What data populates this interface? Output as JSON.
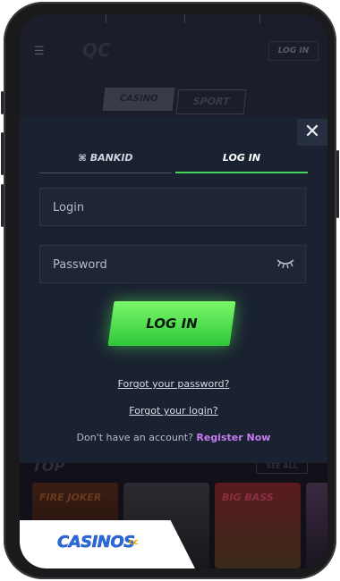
{
  "background_site": {
    "logo": "QC",
    "header_login": "LOG IN",
    "categories": [
      "CASINO",
      "SPORT"
    ],
    "section_title": "TOP",
    "see_all": "SEE ALL",
    "tiles": [
      {
        "title": "FIRE JOKER"
      },
      {
        "title": ""
      },
      {
        "title": "BIG BASS"
      },
      {
        "title": ""
      }
    ]
  },
  "modal": {
    "close_symbol": "✕",
    "tabs": [
      {
        "label": "BANKID",
        "active": false
      },
      {
        "label": "LOG IN",
        "active": true
      }
    ],
    "login_field": {
      "placeholder": "Login"
    },
    "password_field": {
      "placeholder": "Password"
    },
    "submit_label": "LOG IN",
    "forgot_password": "Forgot your password?",
    "forgot_login": "Forgot your login?",
    "no_account_text": "Don't have an account?",
    "register_link": "Register Now"
  },
  "watermark": {
    "brand": "CASINOS",
    "suffix": "cc"
  },
  "colors": {
    "accent_green": "#46d65a",
    "register_purple": "#c47cf0",
    "modal_bg": "#1a2130"
  }
}
